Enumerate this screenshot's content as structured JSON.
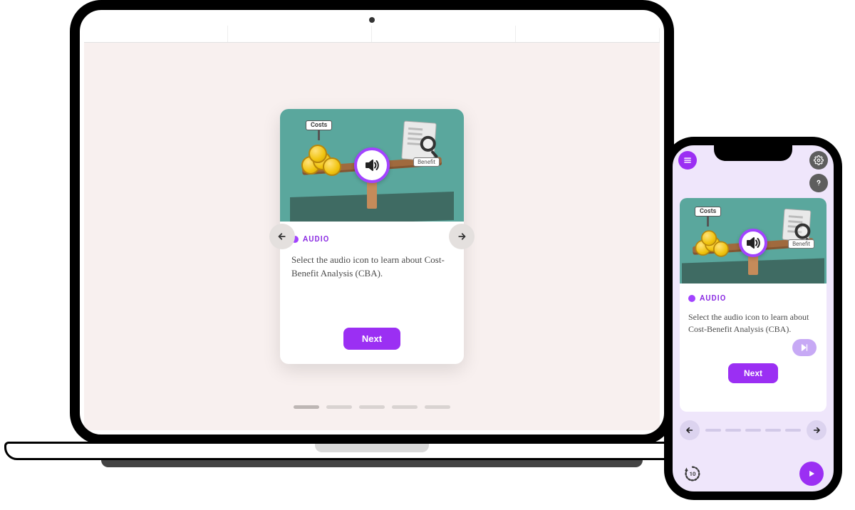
{
  "colors": {
    "accent": "#9b2ff3",
    "teal": "#5aa79d"
  },
  "illustration": {
    "costs_label": "Costs",
    "benefit_label": "Benefit"
  },
  "laptop": {
    "card": {
      "tag": "AUDIO",
      "body": "Select the audio icon to learn about Cost-Benefit Analysis (CBA).",
      "next": "Next"
    },
    "carousel_segments": 5
  },
  "phone": {
    "card": {
      "tag": "AUDIO",
      "body": "Select the audio icon to learn about Cost-Benefit Analysis (CBA).",
      "next": "Next"
    },
    "rewind_label": "10",
    "carousel_segments": 5
  }
}
